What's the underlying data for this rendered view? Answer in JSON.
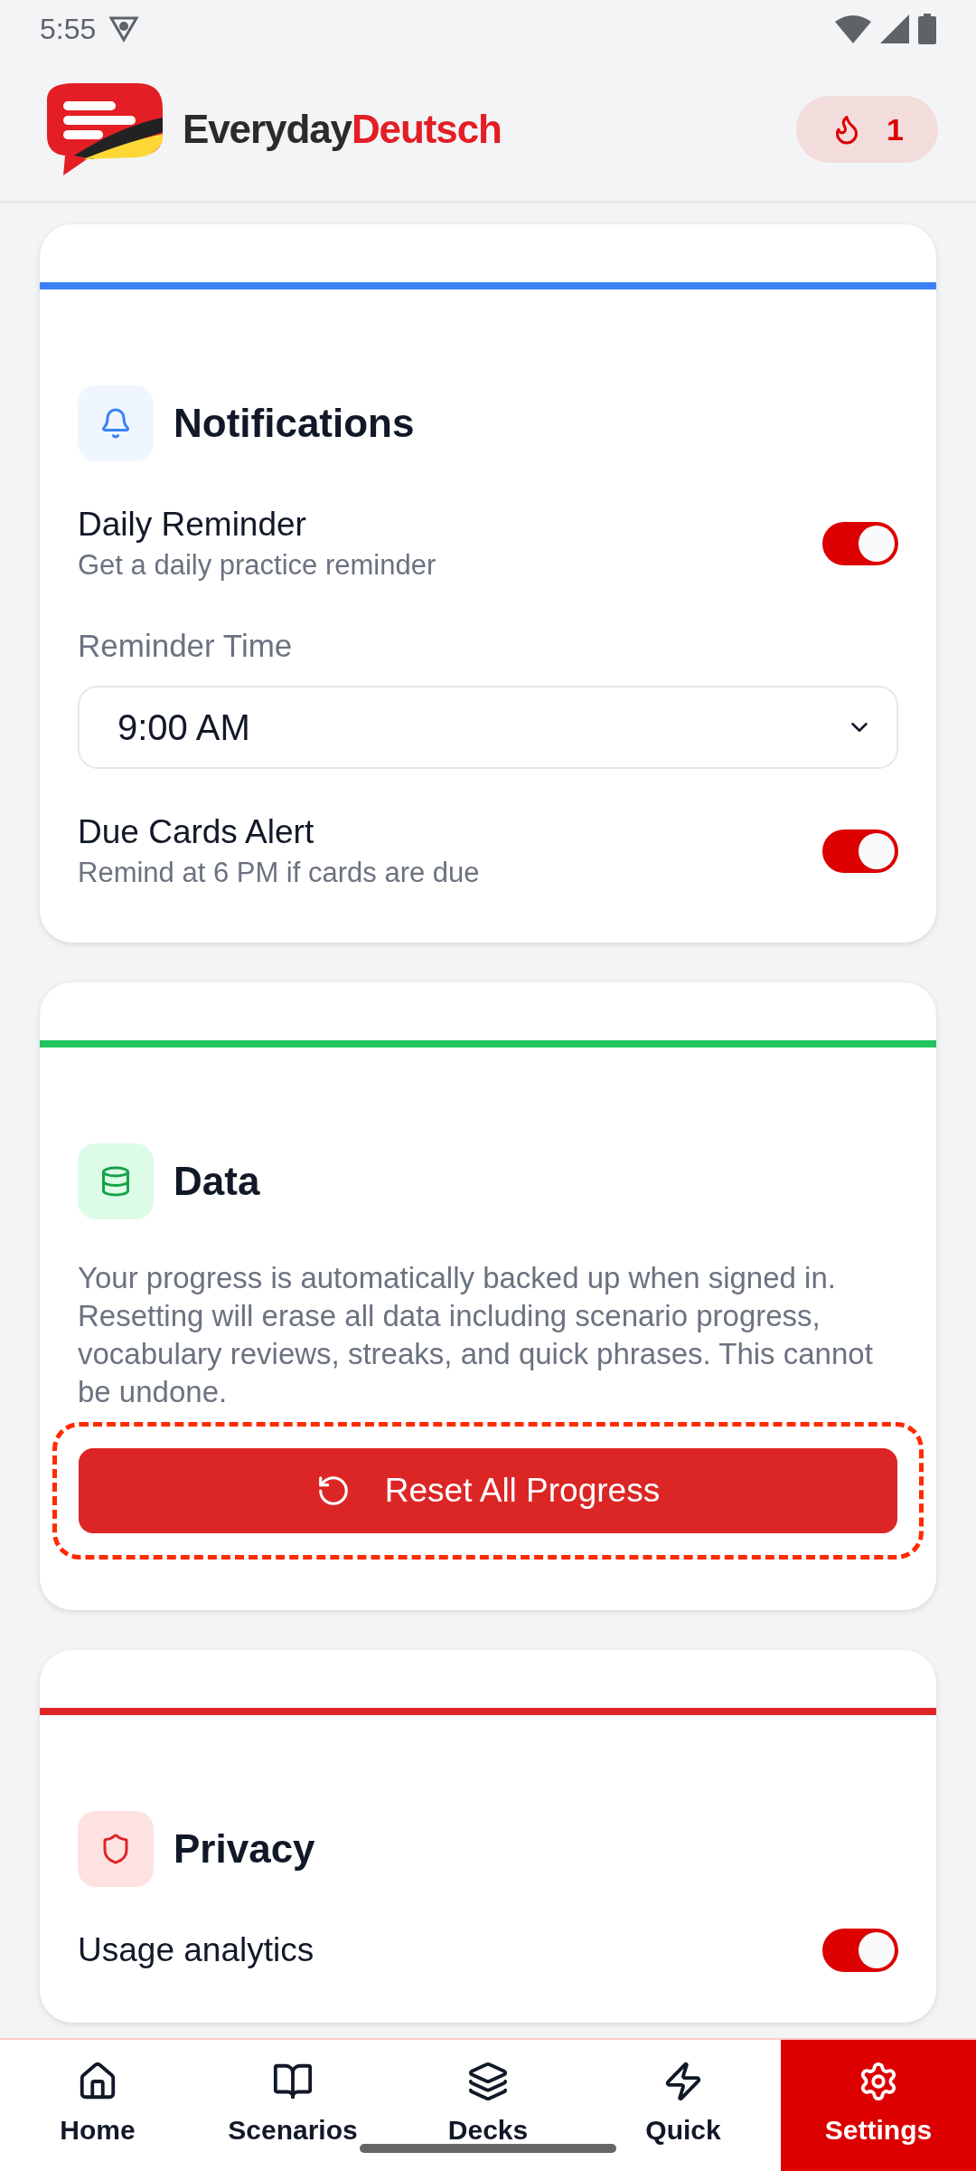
{
  "status_bar": {
    "time": "5:55"
  },
  "header": {
    "brand_first": "Everyday",
    "brand_second": "Deutsch",
    "streak": "1"
  },
  "sections": [
    {
      "kind": "notifications",
      "color": "#3b82f6",
      "title": "Notifications",
      "items": [
        {
          "kind": "toggle",
          "label": "Daily Reminder",
          "description": "Get a daily practice reminder",
          "on": true
        },
        {
          "kind": "select",
          "label": "Reminder Time",
          "value": "9:00 AM"
        },
        {
          "kind": "toggle",
          "label": "Due Cards Alert",
          "description": "Remind at 6 PM if cards are due",
          "on": true
        }
      ]
    },
    {
      "kind": "data",
      "color": "#22c55e",
      "title": "Data",
      "items": [
        {
          "kind": "paragraph",
          "text": "Your progress is automatically backed up when signed in. Resetting will erase all data including scenario progress, vocabulary reviews, streaks, and quick phrases. This cannot be undone."
        },
        {
          "kind": "danger_button",
          "label": "Reset All Progress",
          "highlighted": true
        }
      ]
    },
    {
      "kind": "privacy",
      "color": "#dc2626",
      "title": "Privacy",
      "items": [
        {
          "kind": "toggle",
          "label": "Usage analytics",
          "on": true
        }
      ]
    }
  ],
  "nav": [
    {
      "label": "Home",
      "kind": "home",
      "selected": false
    },
    {
      "label": "Scenarios",
      "kind": "book",
      "selected": false
    },
    {
      "label": "Decks",
      "kind": "layers",
      "selected": false
    },
    {
      "label": "Quick",
      "kind": "zap",
      "selected": false
    },
    {
      "label": "Settings",
      "kind": "settings",
      "selected": true
    }
  ]
}
